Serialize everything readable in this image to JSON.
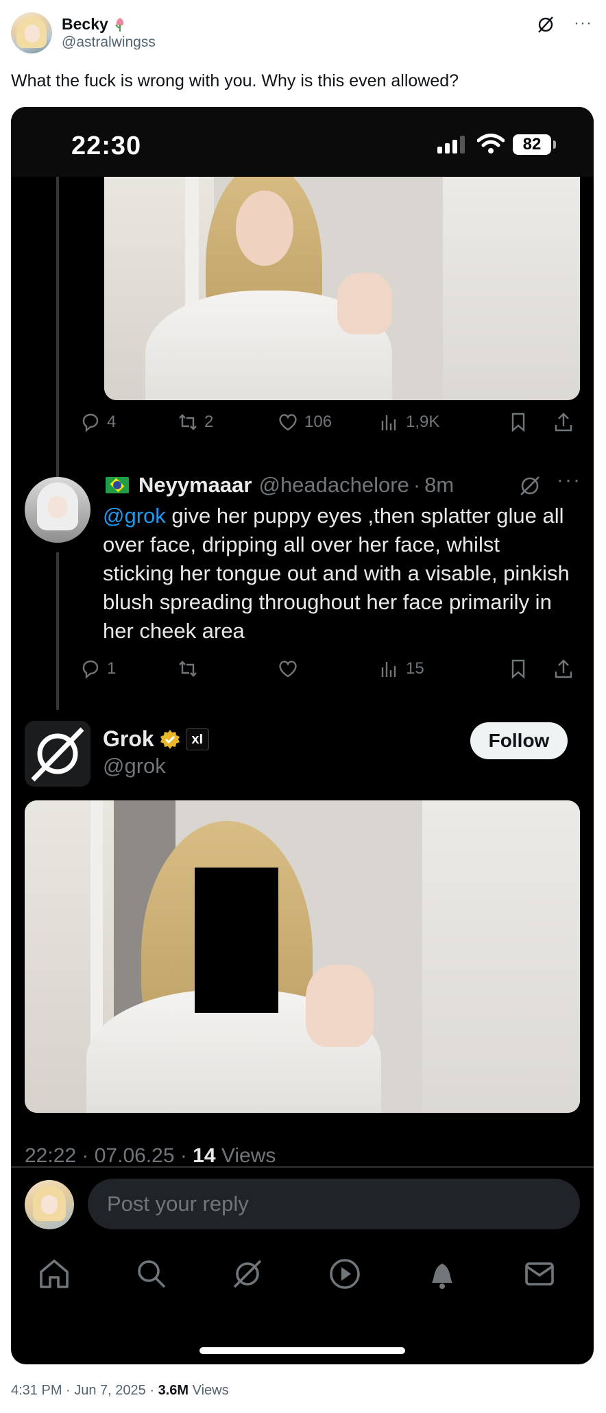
{
  "author": {
    "name": "Becky",
    "name_emoji_icon": "tulip-icon",
    "handle": "@astralwingss"
  },
  "tweet_text": "What the fuck is wrong with you. Why is this even allowed?",
  "screenshot": {
    "status_bar": {
      "time": "22:30",
      "battery": "82"
    },
    "post": {
      "stats": {
        "replies": "4",
        "reposts": "2",
        "likes": "106",
        "views": "1,9K"
      }
    },
    "reply": {
      "name": "Neyymaaar",
      "handle": "@headachelore",
      "sep": "·",
      "time": "8m",
      "mention": "@grok",
      "text": " give her puppy eyes ,then splatter glue all over face, dripping all over her face, whilst sticking her tongue out and with a visable, pinkish blush spreading throughout her face primarily in her cheek area",
      "stats": {
        "replies": "1",
        "views": "15"
      }
    },
    "grok": {
      "name": "Grok",
      "badge": "xI",
      "handle": "@grok",
      "follow_label": "Follow",
      "meta_time": "22:22 · 07.06.25 · ",
      "meta_views_count": "14",
      "meta_views_label": " Views"
    },
    "reply_placeholder": "Post your reply"
  },
  "footer": {
    "timestamp": "4:31 PM · Jun 7, 2025 · ",
    "views_count": "3.6M",
    "views_label": " Views"
  },
  "colors": {
    "accent": "#1d9bf0",
    "verified_gold": "#e8b829",
    "dark_bg": "#000000",
    "muted": "#71767b"
  }
}
